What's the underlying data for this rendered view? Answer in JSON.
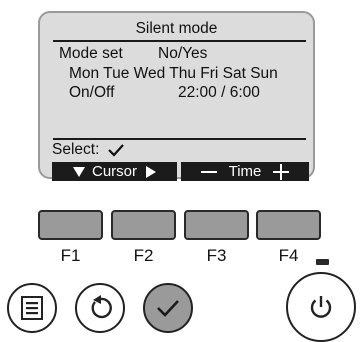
{
  "screen": {
    "title": "Silent mode",
    "mode_set_label": "Mode set",
    "mode_set_value": "No/Yes",
    "days": "Mon Tue Wed Thu Fri Sat Sun",
    "on_off_label": "On/Off",
    "on_off_value": "22:00 / 6:00",
    "select_label": "Select:"
  },
  "softkeys": {
    "cursor_label": "Cursor",
    "time_label": "Time"
  },
  "function_buttons": [
    "F1",
    "F2",
    "F3",
    "F4"
  ],
  "icons": [
    "menu-icon",
    "return-icon",
    "check-icon",
    "power-icon"
  ],
  "colors": {
    "screen_bg": "#dcdcdc",
    "softkey_bg": "#1b1b1b",
    "button_grey": "#9a9a9a",
    "indicator": "#2a2a2a"
  }
}
